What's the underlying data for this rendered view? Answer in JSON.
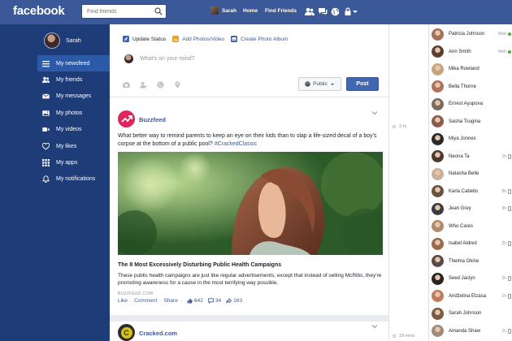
{
  "topbar": {
    "logo": "facebook",
    "search_placeholder": "Find friends",
    "user_name": "Sarah",
    "links": [
      "Home",
      "Find Friends"
    ],
    "bg_color": "#3b5998"
  },
  "sidebar": {
    "user_name": "Sarah",
    "items": [
      {
        "label": "My newsfeed",
        "icon": "list-icon",
        "active": true
      },
      {
        "label": "My friends",
        "icon": "friends-icon",
        "active": false
      },
      {
        "label": "My messages",
        "icon": "envelope-icon",
        "active": false
      },
      {
        "label": "My photos",
        "icon": "photo-icon",
        "active": false
      },
      {
        "label": "My videos",
        "icon": "video-icon",
        "active": false
      },
      {
        "label": "My likes",
        "icon": "heart-icon",
        "active": false
      },
      {
        "label": "My apps",
        "icon": "grid-icon",
        "active": false
      },
      {
        "label": "My notifications",
        "icon": "bell-icon",
        "active": false
      }
    ]
  },
  "composer": {
    "tabs": [
      "Update Status",
      "Add Photos/Video",
      "Create Photo Album"
    ],
    "placeholder": "What's on your mind?",
    "privacy": "Public",
    "post_label": "Post"
  },
  "posts": [
    {
      "page": "Buzzfeed",
      "text": "What better way to remind parents to keep an eye on their kids than to slap a life-sized decal of a boy's corpse at the bottom of a public pool?",
      "hashtag": "#CrackedClassic",
      "link_title": "The 8 Most Excessively Disturbing Public Health Campaigns",
      "link_desc": "These public health campaigns are just like regular advertisements, except that instead of selling McRibs, they're promoting awareness for a cause in the most terrifying way possible.",
      "link_domain": "BUZZFEED.COM",
      "actions": [
        "Like",
        "Comment",
        "Share"
      ],
      "likes": "642",
      "comments": "34",
      "shares": "163",
      "time": "3 hr"
    },
    {
      "page": "Cracked.com",
      "avatar_letter": "C",
      "time": "29 mins"
    }
  ],
  "chat": [
    {
      "name": "Patricia Johnson",
      "status": "Web",
      "online": true,
      "color": "#a0725a"
    },
    {
      "name": "Ann Smith",
      "status": "Web",
      "online": true,
      "color": "#5a4030"
    },
    {
      "name": "Mika Rowland",
      "status": "",
      "online": false,
      "color": "#c9a27e"
    },
    {
      "name": "Bella Thorne",
      "status": "",
      "online": false,
      "color": "#b0705a"
    },
    {
      "name": "Ernest Ayupova",
      "status": "",
      "online": false,
      "color": "#7a6a60"
    },
    {
      "name": "Sasha Tsugina",
      "status": "",
      "online": false,
      "color": "#8a5a4a"
    },
    {
      "name": "Miya Jonnes",
      "status": "",
      "online": false,
      "color": "#2a2a2a"
    },
    {
      "name": "Neona Ta",
      "status": "1h",
      "online": false,
      "color": "#4a3a30"
    },
    {
      "name": "Natasha Belle",
      "status": "",
      "online": false,
      "color": "#c8b09a"
    },
    {
      "name": "Karla Cabello",
      "status": "9h",
      "online": false,
      "color": "#6a5040"
    },
    {
      "name": "Jean Grey",
      "status": "9h",
      "online": false,
      "color": "#3a3a44"
    },
    {
      "name": "Who Cares",
      "status": "",
      "online": false,
      "color": "#b08a6a"
    },
    {
      "name": "Isabel Aldred",
      "status": "2h",
      "online": false,
      "color": "#9a6a4a"
    },
    {
      "name": "Thelma Okine",
      "status": "",
      "online": false,
      "color": "#5a4a4a"
    },
    {
      "name": "Seed Jaclyn",
      "status": "2h",
      "online": false,
      "color": "#2a2420"
    },
    {
      "name": "Andželina Elzasa",
      "status": "1h",
      "online": false,
      "color": "#c07a5a"
    },
    {
      "name": "Sarah Johnson",
      "status": "",
      "online": false,
      "color": "#7a5a40"
    },
    {
      "name": "Amanda Shaw",
      "status": "1h",
      "online": false,
      "color": "#a08a7a"
    }
  ]
}
